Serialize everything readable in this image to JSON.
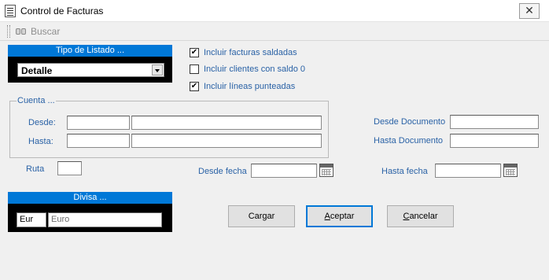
{
  "window": {
    "title": "Control de Facturas",
    "close_glyph": "✕"
  },
  "toolbar": {
    "buscar_label": "Buscar",
    "buscar_enabled": false
  },
  "tipo_listado": {
    "header": "Tipo de Listado ...",
    "selected": "Detalle",
    "accent": "#0078d7"
  },
  "options": [
    {
      "label": "Incluir facturas saldadas",
      "checked": true,
      "mark": "✔"
    },
    {
      "label": "Incluir clientes con saldo 0",
      "checked": false,
      "mark": ""
    },
    {
      "label": "Incluir líneas punteadas",
      "checked": true,
      "mark": "✔"
    }
  ],
  "cuenta": {
    "legend": "Cuenta ...",
    "desde_label": "Desde:",
    "hasta_label": "Hasta:",
    "desde_code": "",
    "desde_name": "",
    "hasta_code": "",
    "hasta_name": ""
  },
  "documento": {
    "desde_label": "Desde Documento",
    "hasta_label": "Hasta Documento",
    "desde_value": "",
    "hasta_value": ""
  },
  "ruta": {
    "label": "Ruta",
    "value": ""
  },
  "fechas": {
    "desde_label": "Desde fecha",
    "hasta_label": "Hasta fecha",
    "desde_value": "",
    "hasta_value": ""
  },
  "divisa": {
    "header": "Divisa ...",
    "code": "Eur",
    "name": "Euro"
  },
  "buttons": {
    "cargar": "Cargar",
    "aceptar_mnemonic": "A",
    "aceptar_rest": "ceptar",
    "cancelar_mnemonic": "C",
    "cancelar_rest": "ancelar"
  },
  "colors": {
    "label_blue": "#2a62a6",
    "header_blue": "#0078d7",
    "panel_black": "#000000"
  }
}
